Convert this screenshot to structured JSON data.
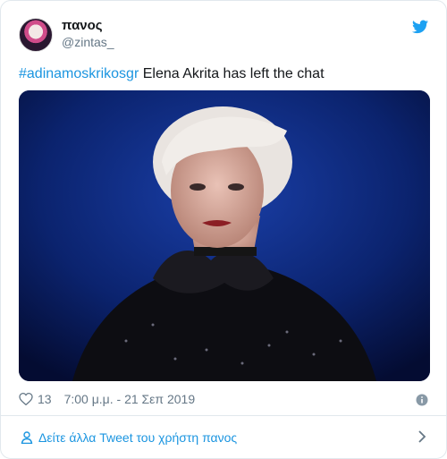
{
  "user": {
    "display_name": "πανος",
    "handle": "@zintas_"
  },
  "tweet": {
    "hashtag": "#adinamoskrikosgr",
    "text": " Elena Akrita has left the chat"
  },
  "meta": {
    "like_count": "13",
    "timestamp": "7:00 μ.μ. - 21 Σεπ 2019"
  },
  "footer": {
    "more_tweets_label": "Δείτε άλλα Tweet του χρήστη πανος"
  },
  "colors": {
    "accent": "#1b95e0",
    "text": "#14171a",
    "muted": "#657786"
  },
  "icons": [
    "twitter-bird-icon",
    "heart-icon",
    "info-icon",
    "person-icon",
    "chevron-right-icon"
  ]
}
